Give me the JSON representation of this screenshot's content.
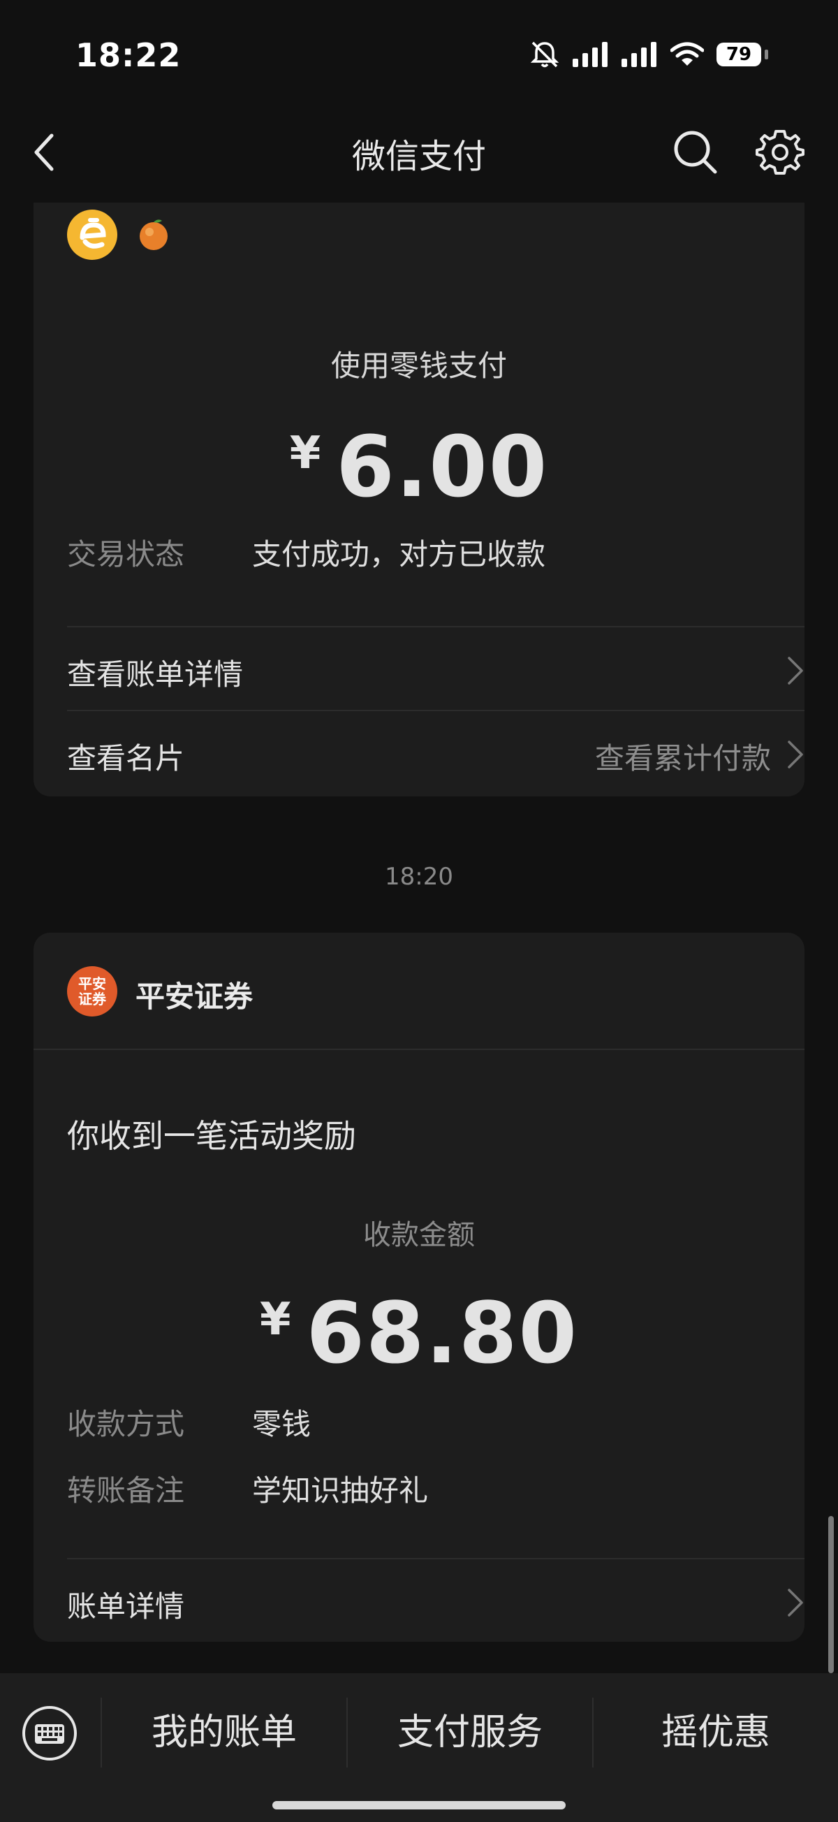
{
  "status_bar": {
    "time": "18:22",
    "battery": "79"
  },
  "nav": {
    "title": "微信支付"
  },
  "payment_card": {
    "pay_method": "使用零钱支付",
    "currency": "¥",
    "amount": "6.00",
    "status_label": "交易状态",
    "status_value": "支付成功，对方已收款",
    "bill_details": "查看账单详情",
    "business_card": "查看名片",
    "cumulative": "查看累计付款"
  },
  "time_separator": "18:20",
  "reward_card": {
    "logo_text": "平安证券",
    "merchant": "平安证券",
    "title": "你收到一笔活动奖励",
    "receive_label": "收款金额",
    "currency": "¥",
    "amount": "68.80",
    "method_label": "收款方式",
    "method_value": "零钱",
    "note_label": "转账备注",
    "note_value": "学知识抽好礼",
    "bill_details": "账单详情"
  },
  "bottom_bar": {
    "tabs": [
      {
        "label": "我的账单"
      },
      {
        "label": "支付服务"
      },
      {
        "label": "摇优惠"
      }
    ]
  },
  "colors": {
    "background": "#111111",
    "card": "#1d1d1d",
    "merchant_logo": "#f5b731",
    "pingan_logo": "#e05a2a"
  }
}
